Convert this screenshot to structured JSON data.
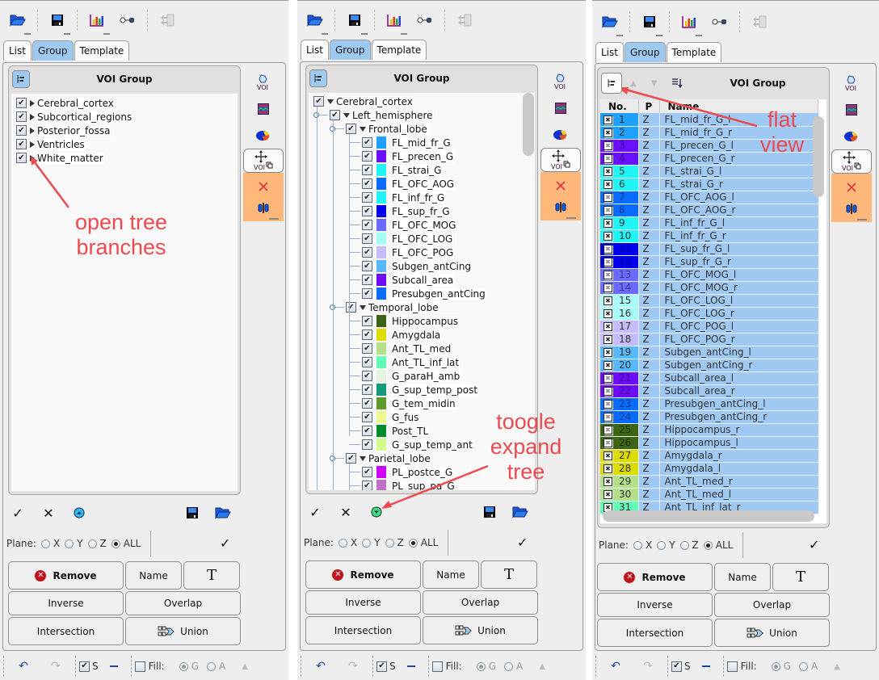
{
  "toolbar": {
    "icons": [
      "open-folder-icon",
      "save-disk-icon",
      "bar-chart-icon",
      "key-slider-icon",
      "export-tree-icon"
    ]
  },
  "tabs": [
    {
      "label": "List",
      "active": false
    },
    {
      "label": "Group",
      "active": true
    },
    {
      "label": "Template",
      "active": false
    }
  ],
  "voi_group_title": "VOI Group",
  "side_tools": {
    "voi_label": "VOI",
    "move_label": "VOI"
  },
  "colors": {
    "tab_active": "#9ec9f0",
    "orange_panel": "#ffb87a",
    "selection": "#9fc8f2",
    "annotation": "#ec4a4f"
  },
  "panel1": {
    "tree": [
      {
        "label": "Cerebral_cortex",
        "checked": true,
        "expanded": false
      },
      {
        "label": "Subcortical_regions",
        "checked": true,
        "expanded": false
      },
      {
        "label": "Posterior_fossa",
        "checked": true,
        "expanded": false
      },
      {
        "label": "Ventricles",
        "checked": true,
        "expanded": false
      },
      {
        "label": "White_matter",
        "checked": true,
        "expanded": false
      }
    ],
    "annotation": "open tree\nbranches",
    "annotation_l1": "open tree",
    "annotation_l2": "branches"
  },
  "panel2": {
    "tree": [
      {
        "level": 0,
        "label": "Cerebral_cortex",
        "type": "group"
      },
      {
        "level": 1,
        "label": "Left_hemisphere",
        "type": "group"
      },
      {
        "level": 2,
        "label": "Frontal_lobe",
        "type": "group"
      },
      {
        "level": 3,
        "label": "FL_mid_fr_G",
        "color": "#1ea0ff"
      },
      {
        "level": 3,
        "label": "FL_precen_G",
        "color": "#6a10ff"
      },
      {
        "level": 3,
        "label": "FL_strai_G",
        "color": "#20f4f4"
      },
      {
        "level": 3,
        "label": "FL_OFC_AOG",
        "color": "#0a6cff"
      },
      {
        "level": 3,
        "label": "FL_inf_fr_G",
        "color": "#20f4f4"
      },
      {
        "level": 3,
        "label": "FL_sup_fr_G",
        "color": "#0000ee"
      },
      {
        "level": 3,
        "label": "FL_OFC_MOG",
        "color": "#6a6aff"
      },
      {
        "level": 3,
        "label": "FL_OFC_LOG",
        "color": "#a8fcf8"
      },
      {
        "level": 3,
        "label": "FL_OFC_POG",
        "color": "#c4bcfc"
      },
      {
        "level": 3,
        "label": "Subgen_antCing",
        "color": "#58b8ff"
      },
      {
        "level": 3,
        "label": "Subcall_area",
        "color": "#6c0cf8"
      },
      {
        "level": 3,
        "label": "Presubgen_antCing",
        "color": "#0a6cff"
      },
      {
        "level": 2,
        "label": "Temporal_lobe",
        "type": "group"
      },
      {
        "level": 3,
        "label": "Hippocampus",
        "color": "#3c6414"
      },
      {
        "level": 3,
        "label": "Amygdala",
        "color": "#dcdc00"
      },
      {
        "level": 3,
        "label": "Ant_TL_med",
        "color": "#b4e08c"
      },
      {
        "level": 3,
        "label": "Ant_TL_inf_lat",
        "color": "#64fcb4"
      },
      {
        "level": 3,
        "label": "G_paraH_amb",
        "color": "#e4f4dc"
      },
      {
        "level": 3,
        "label": "G_sup_temp_post",
        "color": "#149c78"
      },
      {
        "level": 3,
        "label": "G_tem_midin",
        "color": "#5c9c28"
      },
      {
        "level": 3,
        "label": "G_fus",
        "color": "#ecf88c"
      },
      {
        "level": 3,
        "label": "Post_TL",
        "color": "#008c2c"
      },
      {
        "level": 3,
        "label": "G_sup_temp_ant",
        "color": "#d4fc8c"
      },
      {
        "level": 2,
        "label": "Parietal_lobe",
        "type": "group"
      },
      {
        "level": 3,
        "label": "PL_postce_G",
        "color": "#d000f8"
      },
      {
        "level": 3,
        "label": "PL_sup_pa_G",
        "color": "#c070c8"
      }
    ],
    "annotation_l1": "toogle",
    "annotation_l2": "expand",
    "annotation_l3": "tree"
  },
  "panel3": {
    "columns": [
      "No.",
      "P",
      "Name"
    ],
    "rows": [
      {
        "no": "1",
        "p": "Z",
        "name": "FL_mid_fr_G_l",
        "color": "#1ea0ff"
      },
      {
        "no": "2",
        "p": "Z",
        "name": "FL_mid_fr_G_r",
        "color": "#1ea0ff"
      },
      {
        "no": "3",
        "p": "Z",
        "name": "FL_precen_G_l",
        "color": "#6a10ff"
      },
      {
        "no": "4",
        "p": "Z",
        "name": "FL_precen_G_r",
        "color": "#6a10ff"
      },
      {
        "no": "5",
        "p": "Z",
        "name": "FL_strai_G_l",
        "color": "#20f4f4"
      },
      {
        "no": "6",
        "p": "Z",
        "name": "FL_strai_G_r",
        "color": "#20f4f4"
      },
      {
        "no": "7",
        "p": "Z",
        "name": "FL_OFC_AOG_l",
        "color": "#0a6cff"
      },
      {
        "no": "8",
        "p": "Z",
        "name": "FL_OFC_AOG_r",
        "color": "#0a6cff"
      },
      {
        "no": "9",
        "p": "Z",
        "name": "FL_inf_fr_G_l",
        "color": "#20f4f4"
      },
      {
        "no": "10",
        "p": "Z",
        "name": "FL_inf_fr_G_r",
        "color": "#20f4f4"
      },
      {
        "no": "11",
        "p": "Z",
        "name": "FL_sup_fr_G_l",
        "color": "#0000ee"
      },
      {
        "no": "12",
        "p": "Z",
        "name": "FL_sup_fr_G_r",
        "color": "#0000ee"
      },
      {
        "no": "13",
        "p": "Z",
        "name": "FL_OFC_MOG_l",
        "color": "#6a6aff"
      },
      {
        "no": "14",
        "p": "Z",
        "name": "FL_OFC_MOG_r",
        "color": "#6a6aff"
      },
      {
        "no": "15",
        "p": "Z",
        "name": "FL_OFC_LOG_l",
        "color": "#a8fcf8"
      },
      {
        "no": "16",
        "p": "Z",
        "name": "FL_OFC_LOG_r",
        "color": "#a8fcf8"
      },
      {
        "no": "17",
        "p": "Z",
        "name": "FL_OFC_POG_l",
        "color": "#c4bcfc"
      },
      {
        "no": "18",
        "p": "Z",
        "name": "FL_OFC_POG_r",
        "color": "#c4bcfc"
      },
      {
        "no": "19",
        "p": "Z",
        "name": "Subgen_antCing_l",
        "color": "#58b8ff"
      },
      {
        "no": "20",
        "p": "Z",
        "name": "Subgen_antCing_r",
        "color": "#58b8ff"
      },
      {
        "no": "21",
        "p": "Z",
        "name": "Subcall_area_l",
        "color": "#6c0cf8"
      },
      {
        "no": "22",
        "p": "Z",
        "name": "Subcall_area_r",
        "color": "#6c0cf8"
      },
      {
        "no": "23",
        "p": "Z",
        "name": "Presubgen_antCing_l",
        "color": "#0a6cff"
      },
      {
        "no": "24",
        "p": "Z",
        "name": "Presubgen_antCing_r",
        "color": "#0a6cff"
      },
      {
        "no": "25",
        "p": "Z",
        "name": "Hippocampus_r",
        "color": "#3c6414"
      },
      {
        "no": "26",
        "p": "Z",
        "name": "Hippocampus_l",
        "color": "#3c6414"
      },
      {
        "no": "27",
        "p": "Z",
        "name": "Amygdala_r",
        "color": "#dcdc00"
      },
      {
        "no": "28",
        "p": "Z",
        "name": "Amygdala_l",
        "color": "#dcdc00"
      },
      {
        "no": "29",
        "p": "Z",
        "name": "Ant_TL_med_r",
        "color": "#b4e08c"
      },
      {
        "no": "30",
        "p": "Z",
        "name": "Ant_TL_med_l",
        "color": "#b4e08c"
      },
      {
        "no": "31",
        "p": "Z",
        "name": "Ant_TL_inf_lat_r",
        "color": "#64fcb4"
      }
    ],
    "annotation_l1": "flat",
    "annotation_l2": "view"
  },
  "plane": {
    "label": "Plane:",
    "options": [
      "X",
      "Y",
      "Z",
      "ALL"
    ],
    "selected": "ALL"
  },
  "buttons": {
    "remove": "Remove",
    "name": "Name",
    "text": "T",
    "inverse": "Inverse",
    "overlap": "Overlap",
    "intersection": "Intersection",
    "union": "Union"
  },
  "status": {
    "s_label": "S",
    "s_checked": true,
    "fill_label": "Fill:",
    "fill_checked": false,
    "g_label": "G",
    "a_label": "A",
    "selected": "G"
  }
}
